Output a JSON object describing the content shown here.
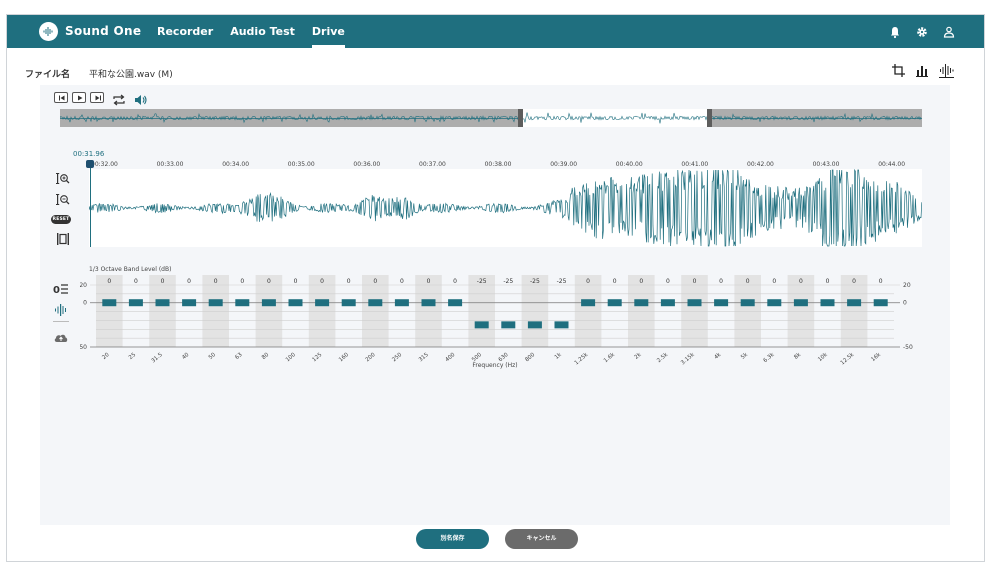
{
  "header": {
    "brand": "Sound One",
    "nav": [
      {
        "label": "Recorder",
        "active": false
      },
      {
        "label": "Audio Test",
        "active": false
      },
      {
        "label": "Drive",
        "active": true
      }
    ],
    "icons": [
      "bell-icon",
      "gear-icon",
      "user-icon"
    ]
  },
  "file": {
    "label": "ファイル名",
    "name": "平和な公園.wav (M)"
  },
  "timeline": {
    "cursor": "00:31.96",
    "ticks": [
      "00:32.00",
      "00:33.00",
      "00:34.00",
      "00:35.00",
      "00:36.00",
      "00:37.00",
      "00:38.00",
      "00:39.00",
      "00:40.00",
      "00:41.00",
      "00:42.00",
      "00:43.00",
      "00:44.00"
    ]
  },
  "tools": {
    "reset": "RESET"
  },
  "band": {
    "title": "1/3 Octave Band Level (dB)",
    "xlabel": "Frequency (Hz)",
    "yticks": {
      "top": "20",
      "zero": "0",
      "bottom": "-50"
    },
    "bands": [
      "20",
      "25",
      "31.5",
      "40",
      "50",
      "63",
      "80",
      "100",
      "125",
      "160",
      "200",
      "250",
      "315",
      "400",
      "500",
      "630",
      "800",
      "1k",
      "1.25k",
      "1.6k",
      "2k",
      "2.5k",
      "3.15k",
      "4k",
      "5k",
      "6.3k",
      "8k",
      "10k",
      "12.5k",
      "16k"
    ],
    "values": [
      0,
      0,
      0,
      0,
      0,
      0,
      0,
      0,
      0,
      0,
      0,
      0,
      0,
      0,
      -25,
      -25,
      -25,
      -25,
      0,
      0,
      0,
      0,
      0,
      0,
      0,
      0,
      0,
      0,
      0,
      0
    ],
    "value_labels": [
      "0",
      "0",
      "0",
      "0",
      "0",
      "0",
      "0",
      "0",
      "0",
      "0",
      "0",
      "0",
      "0",
      "0",
      "-25",
      "-25",
      "-25",
      "-25",
      "0",
      "0",
      "0",
      "0",
      "0",
      "0",
      "0",
      "0",
      "0",
      "0",
      "0",
      "0"
    ],
    "ylim": [
      -50,
      20
    ]
  },
  "actions": {
    "save_as": "別名保存",
    "cancel": "キャンセル"
  },
  "colors": {
    "primary": "#1f6f7f",
    "panel": "#f4f6f9",
    "cancel": "#6b6b6b"
  }
}
